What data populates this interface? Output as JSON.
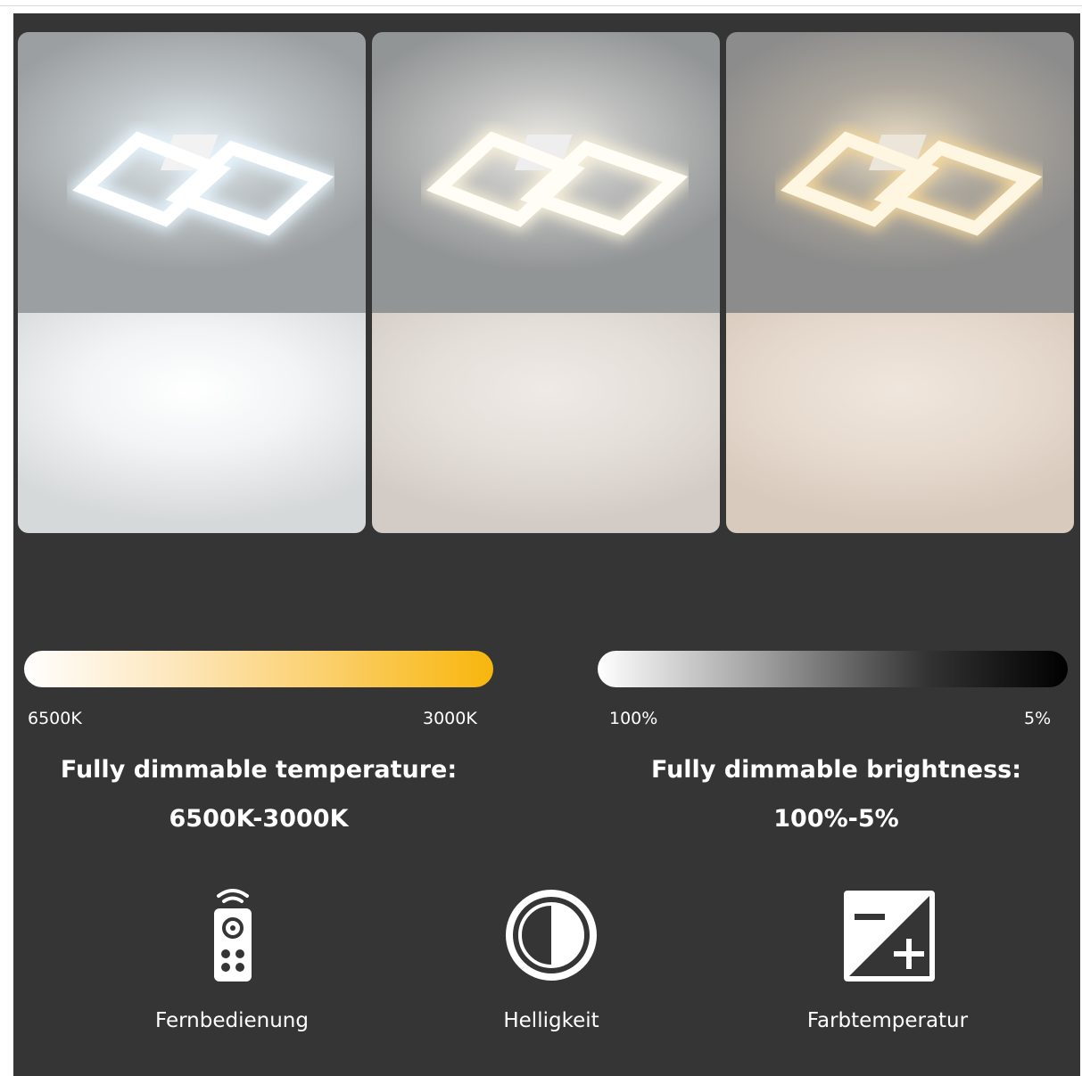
{
  "panels": [
    {
      "name": "cool-white"
    },
    {
      "name": "neutral-white"
    },
    {
      "name": "warm-white"
    }
  ],
  "temperature": {
    "start_label": "6500K",
    "end_label": "3000K",
    "heading": "Fully dimmable temperature:",
    "range": "6500K-3000K",
    "bar_colors": [
      "#ffffff",
      "#f8b60c"
    ]
  },
  "brightness": {
    "start_label": "100%",
    "end_label": "5%",
    "heading": "Fully dimmable brightness:",
    "range": "100%-5%",
    "bar_colors": [
      "#ffffff",
      "#000000"
    ]
  },
  "features": [
    {
      "icon": "remote-control-icon",
      "label": "Fernbedienung"
    },
    {
      "icon": "half-circle-brightness-icon",
      "label": "Helligkeit"
    },
    {
      "icon": "minus-plus-contrast-icon",
      "label": "Farbtemperatur"
    }
  ]
}
